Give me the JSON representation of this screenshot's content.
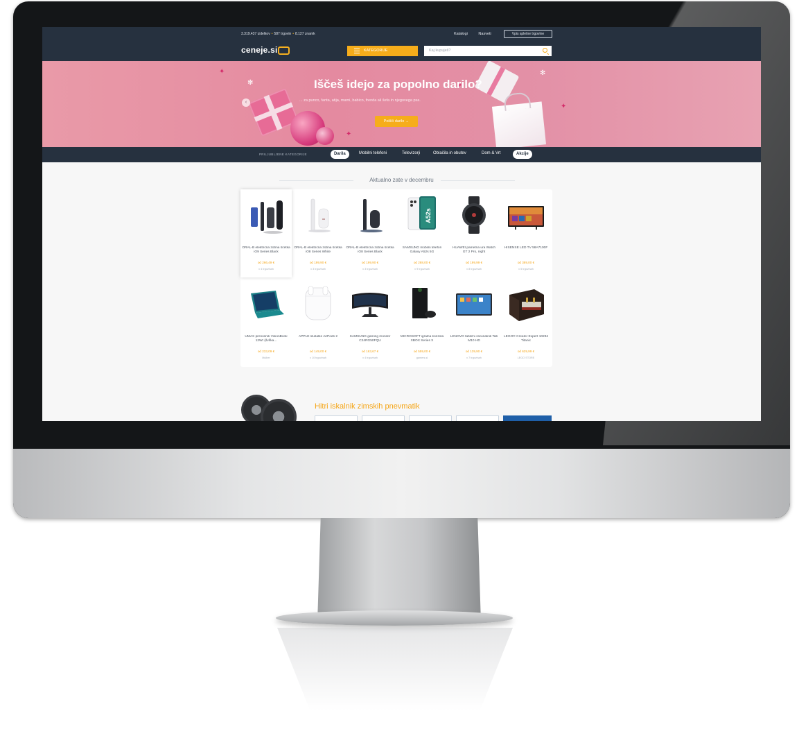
{
  "header": {
    "stats_products": "3.319.437 izdelkov",
    "stats_stores": "587 trgovin",
    "stats_brands": "8.127 znamk",
    "link_catalogs": "Katalogi",
    "link_tips": "Nasveti",
    "register_store": "Vpis spletne trgovine",
    "logo": "ceneje.si",
    "categories_button": "KATEGORIJE",
    "search_placeholder": "Kaj kupuješ?"
  },
  "banner": {
    "title": "Iščeš idejo za popolno darilo?",
    "subtitle": "... za punco, fanta, atija, mami, babico, frenda ali šefa in njegovega psa.",
    "button": "Poišči darilo →"
  },
  "category_nav": {
    "label": "PRILJUBLJENE KATEGORIJE",
    "items": [
      "Darila",
      "Mobilni telefoni",
      "Televizorji",
      "Oblačila in obutev",
      "Dom & Vrt",
      "Akcije"
    ]
  },
  "section": {
    "title": "Aktualno zate v decembru"
  },
  "products": [
    {
      "name": "ORAL-B električna zobna ščetka iO9 Series Black",
      "price": "od 266,49 €",
      "stores": "v 4 trgovinah",
      "icon": "toothbrush-black-icon"
    },
    {
      "name": "ORAL-B električna zobna ščetka iO8 Series White",
      "price": "od 199,90 €",
      "stores": "v 3 trgovinah",
      "icon": "toothbrush-white-icon"
    },
    {
      "name": "ORAL-B električna zobna ščetka iO8 Series Black",
      "price": "od 199,90 €",
      "stores": "v 3 trgovinah",
      "icon": "toothbrush-black-icon"
    },
    {
      "name": "SAMSUNG mobilni telefon Galaxy A52s 5G",
      "price": "od 288,00 €",
      "stores": "v 9 trgovinah",
      "icon": "smartphone-icon"
    },
    {
      "name": "HUAWEI pametna ura Watch GT 2 Pro, night",
      "price": "od 199,99 €",
      "stores": "v 8 trgovinah",
      "icon": "smartwatch-icon"
    },
    {
      "name": "HISENSE LED TV 58A7100F",
      "price": "od 389,00 €",
      "stores": "v 5 trgovinah",
      "icon": "television-icon"
    },
    {
      "name": "UMAX prenosnik VisionBook 12Wr (švška...",
      "price": "od 233,09 €",
      "stores": "Mulher",
      "icon": "laptop-icon"
    },
    {
      "name": "APPLE slušalke AirPods 2",
      "price": "od 149,00 €",
      "stores": "v 10 trgovinah",
      "icon": "earbuds-icon"
    },
    {
      "name": "SAMSUNG gaming monitor C24RG50FQU",
      "price": "od 163,67 €",
      "stores": "v 4 trgovinah",
      "icon": "monitor-icon"
    },
    {
      "name": "MICROSOFT igralna konzola XBOX Series X",
      "price": "od 559,00 €",
      "stores": "gamers.si",
      "icon": "console-icon"
    },
    {
      "name": "LENOVO tablični računalnik Tab M10 HD",
      "price": "od 139,90 €",
      "stores": "v 7 trgovinah",
      "icon": "tablet-icon"
    },
    {
      "name": "LEGO® Creator Expert 10294 Titanic",
      "price": "od 629,99 €",
      "stores": "LEGO STORE",
      "icon": "lego-box-icon"
    }
  ],
  "tires_section": {
    "title": "Hitri iskalnik zimskih pnevmatik"
  },
  "colors": {
    "header_bg": "#26313f",
    "accent": "#f6ad1b",
    "banner_pink": "#e48aa0"
  }
}
